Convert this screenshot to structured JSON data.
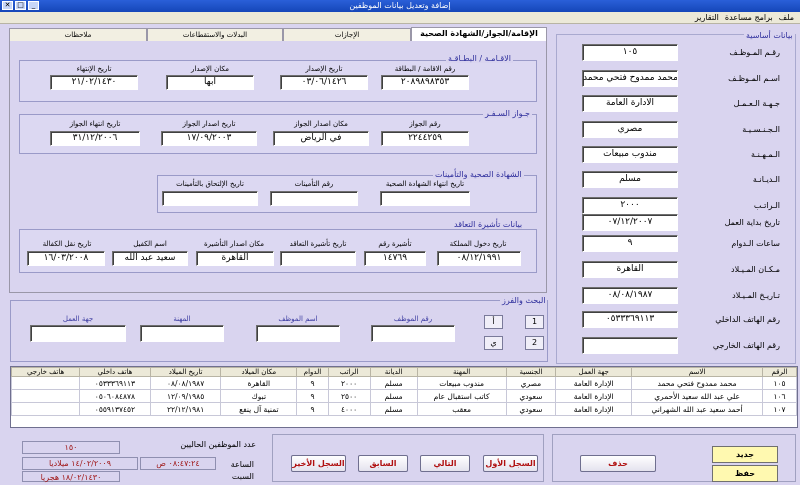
{
  "window": {
    "title": "إضافة وتعديل بيانات الموظفين"
  },
  "menu": [
    "ملف",
    "برامج مساعدة",
    "التقارير"
  ],
  "tabs": [
    "الإقامة/الجواز/الشهادة الصحية",
    "الإجازات",
    "البدلات والاستقطاعات",
    "ملاحظات"
  ],
  "residence_group": {
    "title": "الاقـامـة / البطـاقـة",
    "fields": [
      {
        "label": "رقم الاقامة / البطاقة",
        "value": "٢٠٨٩٨٩٨٣٥٣"
      },
      {
        "label": "تاريخ الإصدار",
        "value": "٠٣/٠٦/١٤٢٦"
      },
      {
        "label": "مكان الإصدار",
        "value": "ابها"
      },
      {
        "label": "تاريخ الإنتهاء",
        "value": "٢١/٠٢/١٤٣٠"
      }
    ]
  },
  "passport_group": {
    "title": "جـواز السـفـر",
    "fields": [
      {
        "label": "رقم الجواز",
        "value": "٢٢٤٤٢٥٩"
      },
      {
        "label": "مكان اصدار الجواز",
        "value": "في الرياض"
      },
      {
        "label": "تاريخ اصدار الجواز",
        "value": "١٧/٠٩/٢٠٠٣"
      },
      {
        "label": "تاريخ انتهاء الجواز",
        "value": "٣١/١٢/٢٠٠٦"
      }
    ]
  },
  "health_group": {
    "title": "الشهادة الصحية والتأمينات",
    "fields": [
      {
        "label": "تاريخ انتهاء الشهادة الصحية",
        "value": ""
      },
      {
        "label": "رقم التأمينات",
        "value": ""
      },
      {
        "label": "تاريخ الإلتحاق بالتأمينات",
        "value": ""
      }
    ]
  },
  "visa_group": {
    "title": "بيانات تأشيرة التعاقد",
    "fields": [
      {
        "label": "تاريخ دخول المملكة",
        "value": "٠٨/١٢/١٩٩١"
      },
      {
        "label": "تأشيرة رقم",
        "value": "١٤٧٦٩"
      },
      {
        "label": "تاريخ تأشيرة التعاقد",
        "value": ""
      },
      {
        "label": "مكان اصدار التأشيرة",
        "value": "القاهرة"
      },
      {
        "label": "اسم الكفيل",
        "value": "سعيد عبد الله"
      },
      {
        "label": "تاريخ نقل الكفالة",
        "value": "١٦/٠٣/٢٠٠٨"
      }
    ]
  },
  "basic_info": {
    "title": "بيانات أساسية",
    "fields": [
      {
        "label": "رقـم المـوظـف",
        "value": "١٠٥"
      },
      {
        "label": "اسـم المـوظـف",
        "value": "محمد ممدوح فتحي محمد"
      },
      {
        "label": "جـهـة الـعـمـل",
        "value": "الادارة العامة"
      },
      {
        "label": "الـجـنـسـيـة",
        "value": "مصري"
      },
      {
        "label": "الـمـهـنـة",
        "value": "مندوب مبيعات"
      },
      {
        "label": "الـديـانـة",
        "value": "مسلم"
      },
      {
        "label": "الـراتـب",
        "value": "٢٠٠٠"
      },
      {
        "label": "تاريخ بداية العمل",
        "value": "٠٧/١٢/٢٠٠٧"
      },
      {
        "label": "ساعات الـدوام",
        "value": "٩"
      },
      {
        "label": "مـكـان المـيـلاد",
        "value": "القاهرة"
      },
      {
        "label": "تـاريـخ المـيـلاد",
        "value": "٠٨/٠٨/١٩٨٧"
      },
      {
        "label": "رقم الهاتف الداخلي",
        "value": "٠٥٣٣٣٦٩١١٣"
      },
      {
        "label": "رقم الهاتف الخارجي",
        "value": ""
      }
    ]
  },
  "search": {
    "title": "البحث والفرز",
    "fields": [
      "رقم الموظف",
      "اسم الموظف",
      "المهنة",
      "جهة العمل"
    ],
    "buttons": [
      "1",
      "أ",
      "2",
      "ي"
    ]
  },
  "grid": {
    "columns": [
      "الرقم",
      "الاسم",
      "جهة العمل",
      "الجنسية",
      "المهنة",
      "الديانة",
      "الراتب",
      "الدوام",
      "مكان الميلاد",
      "تاريخ الميلاد",
      "هاتف داخلي",
      "هاتف خارجي"
    ],
    "rows": [
      [
        "١٠٥",
        "محمد ممدوح فتحي محمد",
        "الإدارة العامة",
        "مصري",
        "مندوب مبيعات",
        "مسلم",
        "٢٠٠٠",
        "٩",
        "القاهرة",
        "٠٨/٠٨/١٩٨٧",
        "٠٥٣٣٣٦٩١١٣",
        ""
      ],
      [
        "١٠٦",
        "علي عبد الله سعيد الأحمري",
        "الإدارة العامة",
        "سعودي",
        "كاتب استقبال عام",
        "مسلم",
        "٢٥٠٠",
        "٩",
        "تبوك",
        "١٢/٠٩/١٩٨٥",
        "٠٥٠٦٠٨٤٨٧٨",
        ""
      ],
      [
        "١٠٧",
        "أحمد سعيد عبد الله الشهراني",
        "الإدارة العامة",
        "سعودي",
        "معقب",
        "مسلم",
        "٤٠٠٠",
        "٩",
        "تمنية آل ينفع",
        "٢٢/١٢/١٩٨١",
        "٠٥٥٩١٣٧٤٥٢",
        ""
      ]
    ]
  },
  "info": {
    "count_label": "عدد الموظفين الحاليين",
    "count_value": "١٥٠",
    "time_label": "الساعة",
    "time_value": "٠٨:٤٧:٢٤ ص",
    "date_value": "١٤/٠٢/٢٠٠٩ ميلاديا",
    "day_label": "السبت",
    "hijri_value": "١٨/٠٢/١٤٣٠ هجريا"
  },
  "nav": {
    "first": "السجل الأول",
    "next": "التالي",
    "prev": "السابق",
    "last": "السجل الأخير"
  },
  "actions": {
    "delete": "حذف",
    "new": "جديد",
    "save": "حفظ"
  }
}
